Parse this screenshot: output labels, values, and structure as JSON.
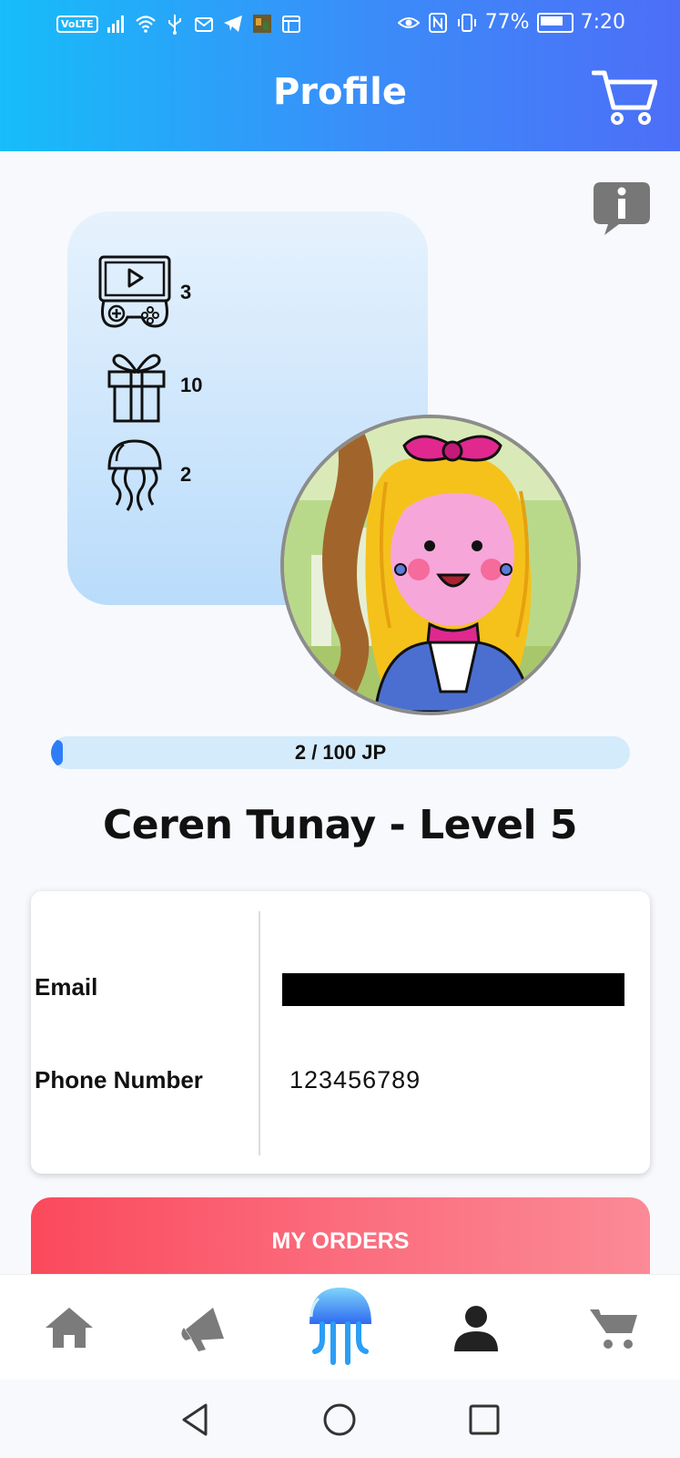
{
  "status_bar": {
    "volte": "VoLTE",
    "battery": "77%",
    "time": "7:20"
  },
  "header": {
    "title": "Profile"
  },
  "stats": [
    {
      "icon": "gamepad-icon",
      "value": "3"
    },
    {
      "icon": "gift-icon",
      "value": "10"
    },
    {
      "icon": "jellyfish-icon",
      "value": "2"
    }
  ],
  "progress": {
    "label": "2 / 100 JP",
    "current": 2,
    "max": 100
  },
  "profile": {
    "name_level": "Ceren Tunay - Level 5"
  },
  "info": {
    "email_label": "Email",
    "email_value": "",
    "phone_label": "Phone Number",
    "phone_value": "123456789"
  },
  "orders_button": "MY ORDERS",
  "bottom_nav": [
    {
      "icon": "home-icon"
    },
    {
      "icon": "megaphone-icon"
    },
    {
      "icon": "jellyfish-icon"
    },
    {
      "icon": "person-icon"
    },
    {
      "icon": "cart-icon"
    }
  ],
  "colors": {
    "header_start": "#16bdf9",
    "header_end": "#4d6ef7",
    "orders_start": "#fa4a5c",
    "orders_end": "#fb8a96",
    "progress_fill": "#2e7df7"
  }
}
